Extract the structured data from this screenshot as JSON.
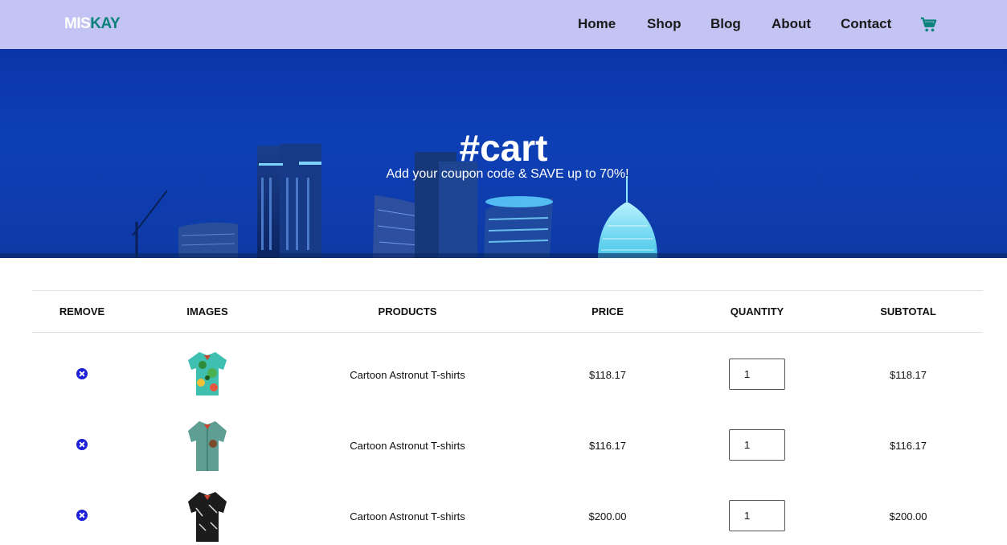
{
  "header": {
    "logo_part1": "MIS",
    "logo_part2": "KAY",
    "nav": [
      "Home",
      "Shop",
      "Blog",
      "About",
      "Contact"
    ],
    "cart_icon": "shopping-cart-icon"
  },
  "hero": {
    "title": "#cart",
    "subtitle": "Add your coupon code & SAVE up to 70%!"
  },
  "table": {
    "headers": [
      "REMOVE",
      "IMAGES",
      "PRODUCTS",
      "PRICE",
      "QUANTITY",
      "SUBTOTAL"
    ],
    "rows": [
      {
        "product": "Cartoon Astronut T-shirts",
        "price": "$118.17",
        "quantity": "1",
        "subtotal": "$118.17",
        "image": "shirt-tropical-green"
      },
      {
        "product": "Cartoon Astronut T-shirts",
        "price": "$116.17",
        "quantity": "1",
        "subtotal": "$116.17",
        "image": "shirt-teal"
      },
      {
        "product": "Cartoon Astronut T-shirts",
        "price": "$200.00",
        "quantity": "1",
        "subtotal": "$200.00",
        "image": "shirt-black"
      }
    ]
  },
  "colors": {
    "header_bg": "#c3c4f3",
    "brand_accent": "#088178",
    "hero_bg": "#0d3fb5",
    "remove_icon": "#1f1fd6"
  }
}
